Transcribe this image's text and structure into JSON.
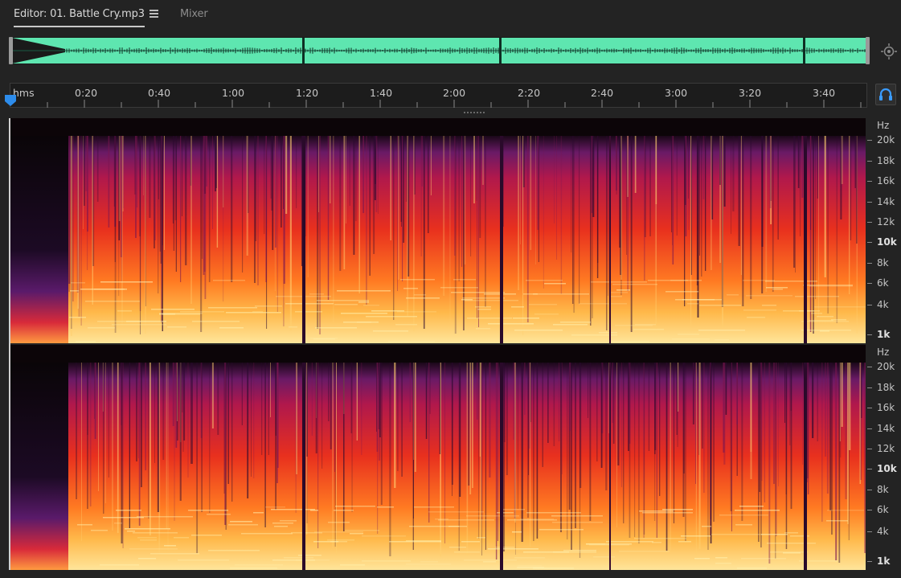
{
  "tabs": {
    "editor_label": "Editor: 01. Battle Cry.mp3",
    "mixer_label": "Mixer"
  },
  "ruler": {
    "unit_label": "hms",
    "time_labels": [
      "0:20",
      "0:40",
      "1:00",
      "1:20",
      "1:40",
      "2:00",
      "2:20",
      "2:40",
      "3:00",
      "3:20",
      "3:40"
    ]
  },
  "frequency_scale": {
    "unit": "Hz",
    "labels": [
      "20k",
      "18k",
      "16k",
      "14k",
      "12k",
      "10k",
      "8k",
      "6k",
      "4k",
      "1k"
    ],
    "bold_labels": [
      "10k",
      "1k"
    ]
  },
  "colors": {
    "waveform": "#5ee6b0",
    "accent": "#2d8ceb",
    "spectrum_low": "#ffe08a",
    "spectrum_mid": "#ff5a1a",
    "spectrum_high": "#c41850",
    "spectrum_top": "#4a1560"
  },
  "icons": {
    "menu": "hamburger-icon",
    "zoom": "zoom-navigator-icon",
    "monitor": "headphones-icon",
    "playhead": "playhead-marker-icon"
  }
}
